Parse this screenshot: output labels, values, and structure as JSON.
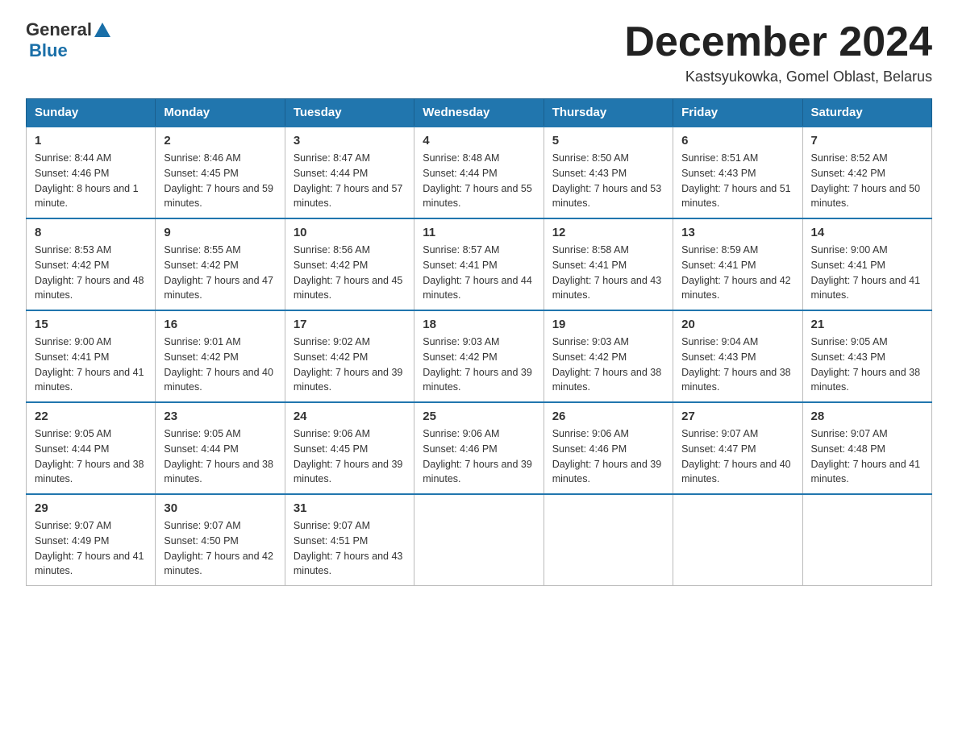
{
  "logo": {
    "general": "General",
    "blue": "Blue"
  },
  "header": {
    "month_title": "December 2024",
    "location": "Kastsyukowka, Gomel Oblast, Belarus"
  },
  "days_of_week": [
    "Sunday",
    "Monday",
    "Tuesday",
    "Wednesday",
    "Thursday",
    "Friday",
    "Saturday"
  ],
  "weeks": [
    [
      {
        "day": "1",
        "sunrise": "8:44 AM",
        "sunset": "4:46 PM",
        "daylight": "8 hours and 1 minute."
      },
      {
        "day": "2",
        "sunrise": "8:46 AM",
        "sunset": "4:45 PM",
        "daylight": "7 hours and 59 minutes."
      },
      {
        "day": "3",
        "sunrise": "8:47 AM",
        "sunset": "4:44 PM",
        "daylight": "7 hours and 57 minutes."
      },
      {
        "day": "4",
        "sunrise": "8:48 AM",
        "sunset": "4:44 PM",
        "daylight": "7 hours and 55 minutes."
      },
      {
        "day": "5",
        "sunrise": "8:50 AM",
        "sunset": "4:43 PM",
        "daylight": "7 hours and 53 minutes."
      },
      {
        "day": "6",
        "sunrise": "8:51 AM",
        "sunset": "4:43 PM",
        "daylight": "7 hours and 51 minutes."
      },
      {
        "day": "7",
        "sunrise": "8:52 AM",
        "sunset": "4:42 PM",
        "daylight": "7 hours and 50 minutes."
      }
    ],
    [
      {
        "day": "8",
        "sunrise": "8:53 AM",
        "sunset": "4:42 PM",
        "daylight": "7 hours and 48 minutes."
      },
      {
        "day": "9",
        "sunrise": "8:55 AM",
        "sunset": "4:42 PM",
        "daylight": "7 hours and 47 minutes."
      },
      {
        "day": "10",
        "sunrise": "8:56 AM",
        "sunset": "4:42 PM",
        "daylight": "7 hours and 45 minutes."
      },
      {
        "day": "11",
        "sunrise": "8:57 AM",
        "sunset": "4:41 PM",
        "daylight": "7 hours and 44 minutes."
      },
      {
        "day": "12",
        "sunrise": "8:58 AM",
        "sunset": "4:41 PM",
        "daylight": "7 hours and 43 minutes."
      },
      {
        "day": "13",
        "sunrise": "8:59 AM",
        "sunset": "4:41 PM",
        "daylight": "7 hours and 42 minutes."
      },
      {
        "day": "14",
        "sunrise": "9:00 AM",
        "sunset": "4:41 PM",
        "daylight": "7 hours and 41 minutes."
      }
    ],
    [
      {
        "day": "15",
        "sunrise": "9:00 AM",
        "sunset": "4:41 PM",
        "daylight": "7 hours and 41 minutes."
      },
      {
        "day": "16",
        "sunrise": "9:01 AM",
        "sunset": "4:42 PM",
        "daylight": "7 hours and 40 minutes."
      },
      {
        "day": "17",
        "sunrise": "9:02 AM",
        "sunset": "4:42 PM",
        "daylight": "7 hours and 39 minutes."
      },
      {
        "day": "18",
        "sunrise": "9:03 AM",
        "sunset": "4:42 PM",
        "daylight": "7 hours and 39 minutes."
      },
      {
        "day": "19",
        "sunrise": "9:03 AM",
        "sunset": "4:42 PM",
        "daylight": "7 hours and 38 minutes."
      },
      {
        "day": "20",
        "sunrise": "9:04 AM",
        "sunset": "4:43 PM",
        "daylight": "7 hours and 38 minutes."
      },
      {
        "day": "21",
        "sunrise": "9:05 AM",
        "sunset": "4:43 PM",
        "daylight": "7 hours and 38 minutes."
      }
    ],
    [
      {
        "day": "22",
        "sunrise": "9:05 AM",
        "sunset": "4:44 PM",
        "daylight": "7 hours and 38 minutes."
      },
      {
        "day": "23",
        "sunrise": "9:05 AM",
        "sunset": "4:44 PM",
        "daylight": "7 hours and 38 minutes."
      },
      {
        "day": "24",
        "sunrise": "9:06 AM",
        "sunset": "4:45 PM",
        "daylight": "7 hours and 39 minutes."
      },
      {
        "day": "25",
        "sunrise": "9:06 AM",
        "sunset": "4:46 PM",
        "daylight": "7 hours and 39 minutes."
      },
      {
        "day": "26",
        "sunrise": "9:06 AM",
        "sunset": "4:46 PM",
        "daylight": "7 hours and 39 minutes."
      },
      {
        "day": "27",
        "sunrise": "9:07 AM",
        "sunset": "4:47 PM",
        "daylight": "7 hours and 40 minutes."
      },
      {
        "day": "28",
        "sunrise": "9:07 AM",
        "sunset": "4:48 PM",
        "daylight": "7 hours and 41 minutes."
      }
    ],
    [
      {
        "day": "29",
        "sunrise": "9:07 AM",
        "sunset": "4:49 PM",
        "daylight": "7 hours and 41 minutes."
      },
      {
        "day": "30",
        "sunrise": "9:07 AM",
        "sunset": "4:50 PM",
        "daylight": "7 hours and 42 minutes."
      },
      {
        "day": "31",
        "sunrise": "9:07 AM",
        "sunset": "4:51 PM",
        "daylight": "7 hours and 43 minutes."
      },
      null,
      null,
      null,
      null
    ]
  ]
}
